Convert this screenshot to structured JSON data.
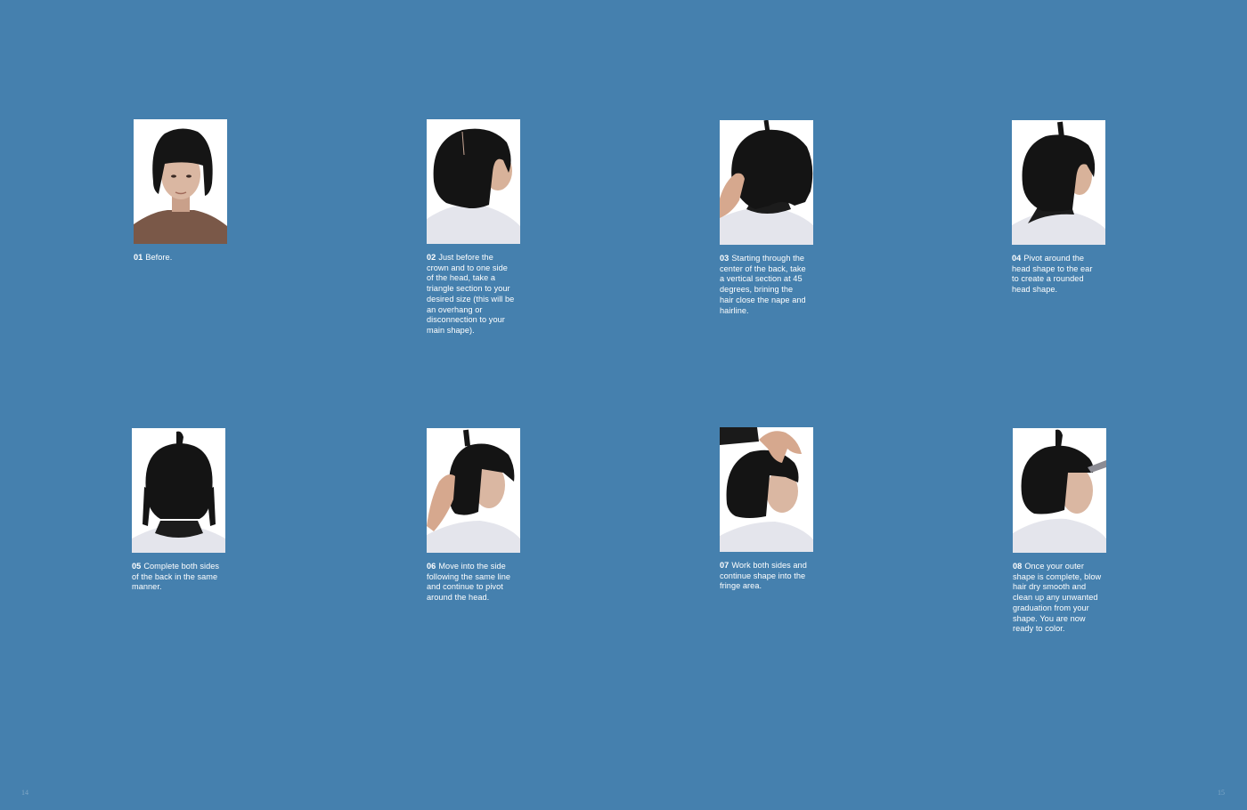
{
  "page_numbers": {
    "left": "14",
    "right": "15"
  },
  "colors": {
    "background": "#4580ae",
    "text": "#ffffff",
    "hair": "#141414",
    "skin": "#d8b29a",
    "cape": "#e6e8f0"
  },
  "steps": [
    {
      "num": "01",
      "text": "Before.",
      "photo": "front-view"
    },
    {
      "num": "02",
      "text": "Just before the crown and to one side of the head, take a triangle section to your desired size (this will be an overhang or disconnection to your main shape).",
      "photo": "three-quarter-back-view"
    },
    {
      "num": "03",
      "text": "Starting through the center of the back, take a vertical section at 45 degrees, brining the hair close the nape and hairline.",
      "photo": "back-view-with-hand"
    },
    {
      "num": "04",
      "text": "Pivot around the head shape to the ear to create a rounded head shape.",
      "photo": "three-quarter-back-view"
    },
    {
      "num": "05",
      "text": "Complete both sides of the back in the same manner.",
      "photo": "back-view"
    },
    {
      "num": "06",
      "text": "Move into the side following the same line and continue to pivot around the head.",
      "photo": "side-view-with-hand"
    },
    {
      "num": "07",
      "text": "Work both sides and continue shape into the fringe area.",
      "photo": "side-view-with-hand"
    },
    {
      "num": "08",
      "text": "Once your outer shape is complete, blow hair dry smooth and clean up any unwanted graduation from your shape. You are now ready to color.",
      "photo": "side-view"
    }
  ]
}
